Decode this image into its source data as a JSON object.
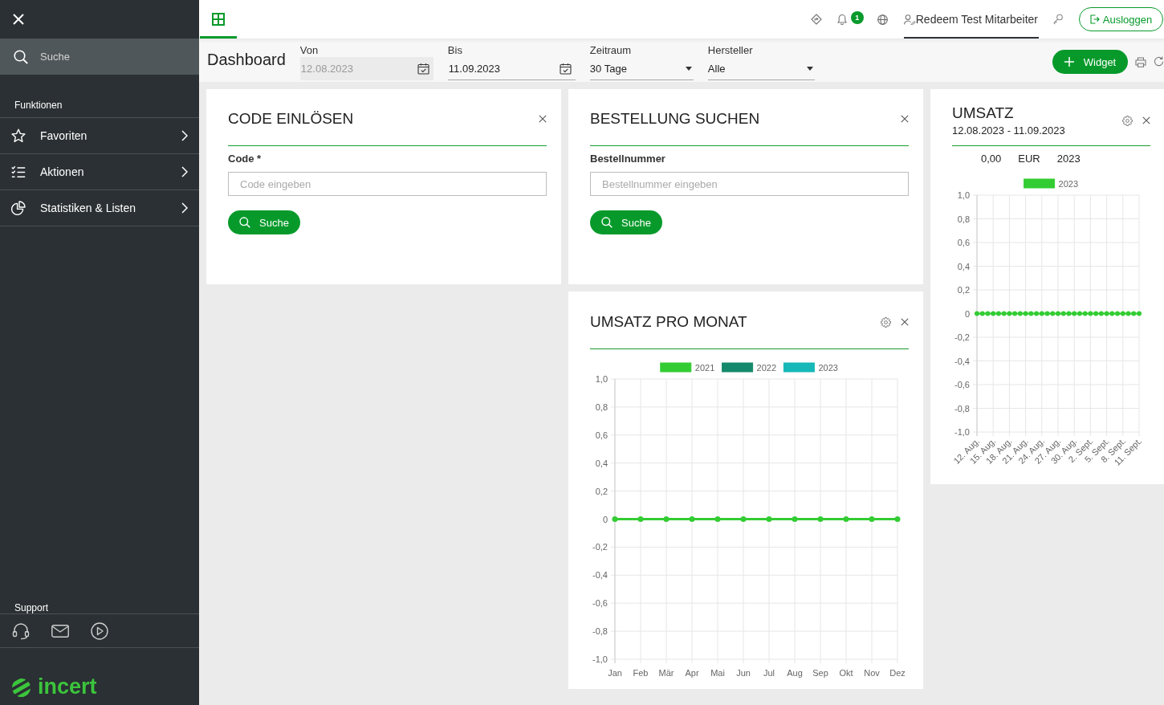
{
  "sidebar": {
    "search": {
      "placeholder": "Suche"
    },
    "section_title": "Funktionen",
    "items": [
      {
        "label": "Favoriten",
        "expanded": false
      },
      {
        "label": "Aktionen",
        "expanded": false
      },
      {
        "label": "Statistiken & Listen",
        "expanded": false
      }
    ],
    "support_title": "Support",
    "logo": "incert"
  },
  "topbar": {
    "home_tab": {
      "selected": true
    },
    "notification_badge": "1",
    "user": {
      "name": "Redeem Test Mitarbeiter",
      "selected": true
    },
    "logout_button": "Ausloggen"
  },
  "toolbar": {
    "title": "Dashboard",
    "filters": [
      {
        "kind": "date",
        "label": "Von",
        "value": "12.08.2023",
        "disabled": true
      },
      {
        "kind": "date",
        "label": "Bis",
        "value": "11.09.2023",
        "disabled": false
      },
      {
        "kind": "select",
        "label": "Zeitraum",
        "value": "30 Tage",
        "disabled": false
      },
      {
        "kind": "select",
        "label": "Hersteller",
        "value": "Alle",
        "disabled": false
      }
    ],
    "add_button": "Widget"
  },
  "columns": [
    {
      "widgets": [
        {
          "kind": "form",
          "title": "CODE EINLÖSEN",
          "field": {
            "label": "Code *",
            "placeholder": "Code eingeben"
          },
          "button": "Suche"
        }
      ]
    },
    {
      "widgets": [
        {
          "kind": "form",
          "title": "BESTELLUNG SUCHEN",
          "field": {
            "label": "Bestellnummer",
            "placeholder": "Bestellnummer eingeben"
          },
          "button": "Suche"
        },
        {
          "kind": "chart",
          "title": "UMSATZ PRO MONAT",
          "chart_data": {
            "type": "line",
            "grid": true,
            "legend": "top",
            "categories": [
              "Jan",
              "Feb",
              "Mär",
              "Apr",
              "Mai",
              "Jun",
              "Jul",
              "Aug",
              "Sep",
              "Okt",
              "Nov",
              "Dez"
            ],
            "series": [
              {
                "name": "2021",
                "color": "#33cc33",
                "marker": "circle",
                "values": [
                  0,
                  0,
                  0,
                  0,
                  0,
                  0,
                  0,
                  0,
                  0,
                  0,
                  0,
                  0
                ]
              },
              {
                "name": "2022",
                "color": "#15896b",
                "values": [
                  null,
                  null,
                  null,
                  null,
                  null,
                  null,
                  null,
                  null,
                  null,
                  null,
                  null,
                  null
                ]
              },
              {
                "name": "2023",
                "color": "#17b8b8",
                "values": [
                  null,
                  null,
                  null,
                  null,
                  null,
                  null,
                  null,
                  null,
                  null,
                  null,
                  null,
                  null
                ]
              }
            ],
            "ylim": [
              -1,
              1
            ],
            "yticks": [
              {
                "value": 1,
                "label": "1,0"
              },
              {
                "value": 0.8,
                "label": "0,8"
              },
              {
                "value": 0.6,
                "label": "0,6"
              },
              {
                "value": 0.4,
                "label": "0,4"
              },
              {
                "value": 0.2,
                "label": "0,2"
              },
              0,
              {
                "value": -0.2,
                "label": "-0,2"
              },
              {
                "value": -0.4,
                "label": "-0,4"
              },
              {
                "value": -0.6,
                "label": "-0,6"
              },
              {
                "value": -0.8,
                "label": "-0,8"
              },
              {
                "value": -1,
                "label": "-1,0"
              }
            ]
          }
        }
      ]
    },
    {
      "widgets": [
        {
          "kind": "chart",
          "title": "UMSATZ",
          "subtitle": "12.08.2023 - 11.09.2023",
          "summary": [
            "0,00",
            "EUR",
            "2023"
          ],
          "chart_data": {
            "type": "line",
            "grid": true,
            "legend": "top",
            "categories": [
              "12. Aug.",
              null,
              null,
              "15. Aug.",
              null,
              null,
              "18. Aug.",
              null,
              null,
              "21. Aug.",
              null,
              null,
              "24. Aug.",
              null,
              null,
              "27. Aug.",
              null,
              null,
              "30. Aug.",
              null,
              null,
              "2. Sept.",
              null,
              null,
              "5. Sept.",
              null,
              null,
              "8. Sept.",
              null,
              null,
              "11. Sept."
            ],
            "series": [
              {
                "name": "2023",
                "color": "#33cc33",
                "marker": "circle",
                "values": [
                  0,
                  0,
                  0,
                  0,
                  0,
                  0,
                  0,
                  0,
                  0,
                  0,
                  0,
                  0,
                  0,
                  0,
                  0,
                  0,
                  0,
                  0,
                  0,
                  0,
                  0,
                  0,
                  0,
                  0,
                  0,
                  0,
                  0,
                  0,
                  0,
                  0,
                  0
                ]
              }
            ],
            "ylim": [
              -1,
              1
            ],
            "yticks": [
              {
                "value": 1,
                "label": "1,0"
              },
              {
                "value": 0.8,
                "label": "0,8"
              },
              {
                "value": 0.6,
                "label": "0,6"
              },
              {
                "value": 0.4,
                "label": "0,4"
              },
              {
                "value": 0.2,
                "label": "0,2"
              },
              0,
              {
                "value": -0.2,
                "label": "-0,2"
              },
              {
                "value": -0.4,
                "label": "-0,4"
              },
              {
                "value": -0.6,
                "label": "-0,6"
              },
              {
                "value": -0.8,
                "label": "-0,8"
              },
              {
                "value": -1,
                "label": "-1,0"
              }
            ]
          }
        }
      ]
    }
  ]
}
